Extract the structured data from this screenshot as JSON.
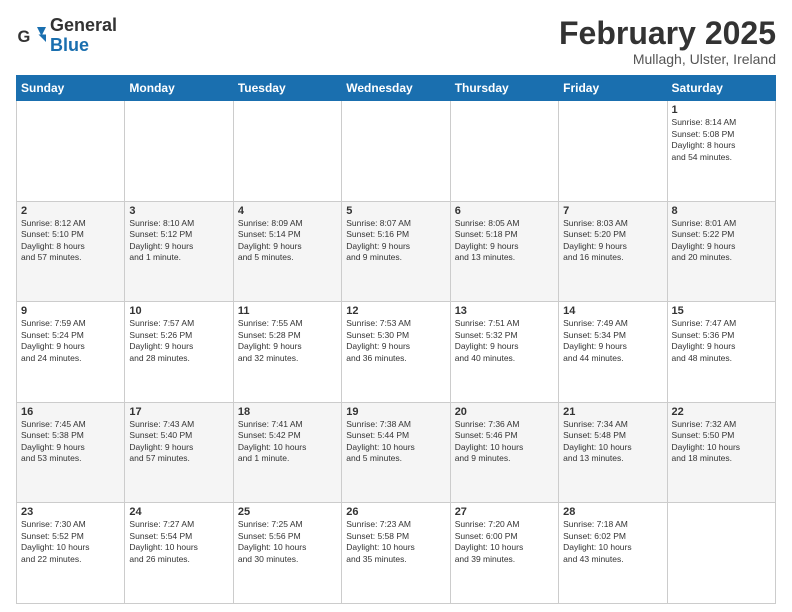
{
  "header": {
    "logo_line1": "General",
    "logo_line2": "Blue",
    "month_title": "February 2025",
    "location": "Mullagh, Ulster, Ireland"
  },
  "days_of_week": [
    "Sunday",
    "Monday",
    "Tuesday",
    "Wednesday",
    "Thursday",
    "Friday",
    "Saturday"
  ],
  "weeks": [
    [
      {
        "day": "",
        "info": ""
      },
      {
        "day": "",
        "info": ""
      },
      {
        "day": "",
        "info": ""
      },
      {
        "day": "",
        "info": ""
      },
      {
        "day": "",
        "info": ""
      },
      {
        "day": "",
        "info": ""
      },
      {
        "day": "1",
        "info": "Sunrise: 8:14 AM\nSunset: 5:08 PM\nDaylight: 8 hours\nand 54 minutes."
      }
    ],
    [
      {
        "day": "2",
        "info": "Sunrise: 8:12 AM\nSunset: 5:10 PM\nDaylight: 8 hours\nand 57 minutes."
      },
      {
        "day": "3",
        "info": "Sunrise: 8:10 AM\nSunset: 5:12 PM\nDaylight: 9 hours\nand 1 minute."
      },
      {
        "day": "4",
        "info": "Sunrise: 8:09 AM\nSunset: 5:14 PM\nDaylight: 9 hours\nand 5 minutes."
      },
      {
        "day": "5",
        "info": "Sunrise: 8:07 AM\nSunset: 5:16 PM\nDaylight: 9 hours\nand 9 minutes."
      },
      {
        "day": "6",
        "info": "Sunrise: 8:05 AM\nSunset: 5:18 PM\nDaylight: 9 hours\nand 13 minutes."
      },
      {
        "day": "7",
        "info": "Sunrise: 8:03 AM\nSunset: 5:20 PM\nDaylight: 9 hours\nand 16 minutes."
      },
      {
        "day": "8",
        "info": "Sunrise: 8:01 AM\nSunset: 5:22 PM\nDaylight: 9 hours\nand 20 minutes."
      }
    ],
    [
      {
        "day": "9",
        "info": "Sunrise: 7:59 AM\nSunset: 5:24 PM\nDaylight: 9 hours\nand 24 minutes."
      },
      {
        "day": "10",
        "info": "Sunrise: 7:57 AM\nSunset: 5:26 PM\nDaylight: 9 hours\nand 28 minutes."
      },
      {
        "day": "11",
        "info": "Sunrise: 7:55 AM\nSunset: 5:28 PM\nDaylight: 9 hours\nand 32 minutes."
      },
      {
        "day": "12",
        "info": "Sunrise: 7:53 AM\nSunset: 5:30 PM\nDaylight: 9 hours\nand 36 minutes."
      },
      {
        "day": "13",
        "info": "Sunrise: 7:51 AM\nSunset: 5:32 PM\nDaylight: 9 hours\nand 40 minutes."
      },
      {
        "day": "14",
        "info": "Sunrise: 7:49 AM\nSunset: 5:34 PM\nDaylight: 9 hours\nand 44 minutes."
      },
      {
        "day": "15",
        "info": "Sunrise: 7:47 AM\nSunset: 5:36 PM\nDaylight: 9 hours\nand 48 minutes."
      }
    ],
    [
      {
        "day": "16",
        "info": "Sunrise: 7:45 AM\nSunset: 5:38 PM\nDaylight: 9 hours\nand 53 minutes."
      },
      {
        "day": "17",
        "info": "Sunrise: 7:43 AM\nSunset: 5:40 PM\nDaylight: 9 hours\nand 57 minutes."
      },
      {
        "day": "18",
        "info": "Sunrise: 7:41 AM\nSunset: 5:42 PM\nDaylight: 10 hours\nand 1 minute."
      },
      {
        "day": "19",
        "info": "Sunrise: 7:38 AM\nSunset: 5:44 PM\nDaylight: 10 hours\nand 5 minutes."
      },
      {
        "day": "20",
        "info": "Sunrise: 7:36 AM\nSunset: 5:46 PM\nDaylight: 10 hours\nand 9 minutes."
      },
      {
        "day": "21",
        "info": "Sunrise: 7:34 AM\nSunset: 5:48 PM\nDaylight: 10 hours\nand 13 minutes."
      },
      {
        "day": "22",
        "info": "Sunrise: 7:32 AM\nSunset: 5:50 PM\nDaylight: 10 hours\nand 18 minutes."
      }
    ],
    [
      {
        "day": "23",
        "info": "Sunrise: 7:30 AM\nSunset: 5:52 PM\nDaylight: 10 hours\nand 22 minutes."
      },
      {
        "day": "24",
        "info": "Sunrise: 7:27 AM\nSunset: 5:54 PM\nDaylight: 10 hours\nand 26 minutes."
      },
      {
        "day": "25",
        "info": "Sunrise: 7:25 AM\nSunset: 5:56 PM\nDaylight: 10 hours\nand 30 minutes."
      },
      {
        "day": "26",
        "info": "Sunrise: 7:23 AM\nSunset: 5:58 PM\nDaylight: 10 hours\nand 35 minutes."
      },
      {
        "day": "27",
        "info": "Sunrise: 7:20 AM\nSunset: 6:00 PM\nDaylight: 10 hours\nand 39 minutes."
      },
      {
        "day": "28",
        "info": "Sunrise: 7:18 AM\nSunset: 6:02 PM\nDaylight: 10 hours\nand 43 minutes."
      },
      {
        "day": "",
        "info": ""
      }
    ]
  ]
}
